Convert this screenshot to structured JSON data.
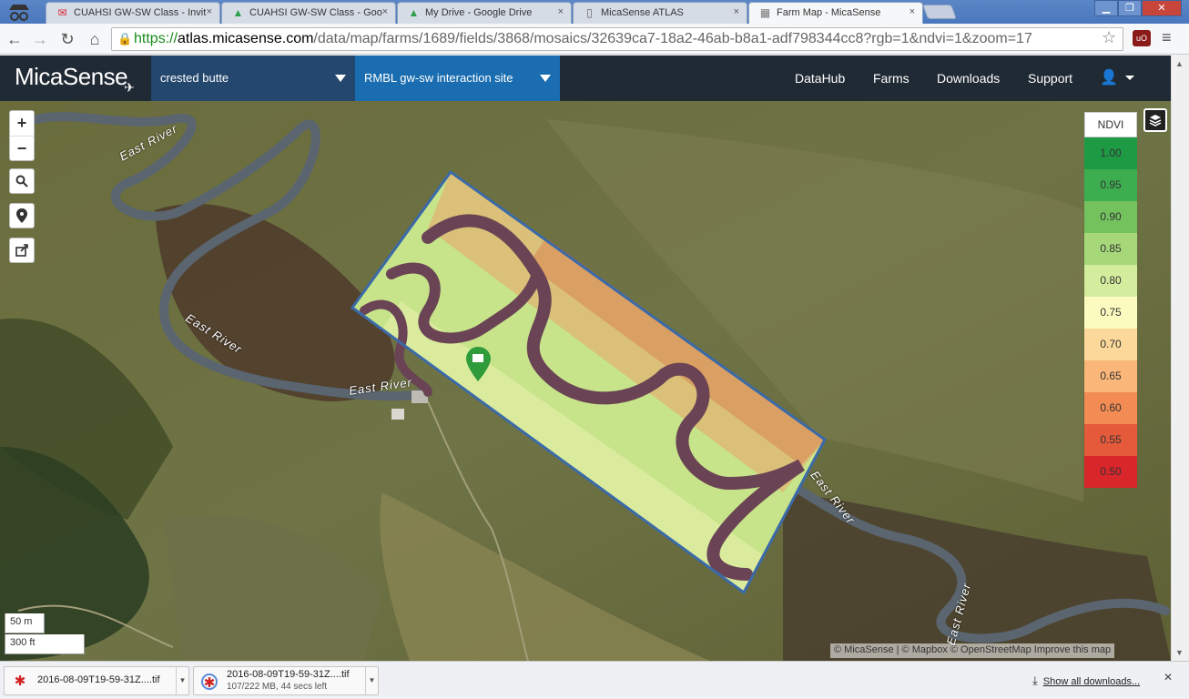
{
  "browser": {
    "tabs": [
      {
        "title": "CUAHSI GW-SW Class - Invit",
        "icon": "gmail-icon"
      },
      {
        "title": "CUAHSI GW-SW Class - Goo",
        "icon": "google-drive-icon"
      },
      {
        "title": "My Drive - Google Drive",
        "icon": "google-drive-icon"
      },
      {
        "title": "MicaSense ATLAS",
        "icon": "document-icon"
      },
      {
        "title": "Farm Map - MicaSense",
        "icon": "micasense-icon"
      }
    ],
    "close_glyph": "×",
    "url": {
      "scheme": "https://",
      "host": "atlas.micasense.com",
      "path": "/data/map/farms/1689/fields/3868/mosaics/32639ca7-18a2-46ab-b8a1-adf798344cc8?rgb=1&ndvi=1&zoom=17"
    }
  },
  "app": {
    "logo": "MicaSense",
    "farm_select": "crested butte",
    "field_select": "RMBL gw-sw interaction site",
    "nav": [
      "DataHub",
      "Farms",
      "Downloads",
      "Support"
    ]
  },
  "map": {
    "zoom_in": "+",
    "zoom_out": "−",
    "river_labels": [
      "East River",
      "East River",
      "East River",
      "East River",
      "East River"
    ],
    "legend": {
      "title": "NDVI",
      "rows": [
        {
          "label": "1.00",
          "color": "#1e9a45"
        },
        {
          "label": "0.95",
          "color": "#3cae4f"
        },
        {
          "label": "0.90",
          "color": "#73c25e"
        },
        {
          "label": "0.85",
          "color": "#a6d87a"
        },
        {
          "label": "0.80",
          "color": "#d3ec9d"
        },
        {
          "label": "0.75",
          "color": "#fbfbc0"
        },
        {
          "label": "0.70",
          "color": "#fcd99a"
        },
        {
          "label": "0.65",
          "color": "#fbb77a"
        },
        {
          "label": "0.60",
          "color": "#f28c54"
        },
        {
          "label": "0.55",
          "color": "#e45a3b"
        },
        {
          "label": "0.50",
          "color": "#d9262a"
        }
      ]
    },
    "scale_metric": "50 m",
    "scale_imperial": "300 ft",
    "attribution": "© MicaSense | © Mapbox © OpenStreetMap Improve this map"
  },
  "downloads": {
    "items": [
      {
        "name": "2016-08-09T19-59-31Z....tif",
        "status": ""
      },
      {
        "name": "2016-08-09T19-59-31Z....tif",
        "status": "107/222 MB, 44 secs left"
      }
    ],
    "show_all": "Show all downloads..."
  }
}
